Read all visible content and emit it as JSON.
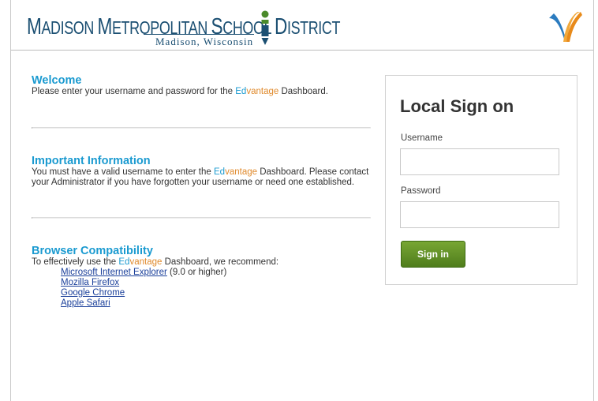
{
  "header": {
    "district_name_parts": [
      "M",
      "ADISON ",
      "M",
      "ETROPOLITAN ",
      "S",
      "CHOOL ",
      "D",
      "ISTRICT"
    ],
    "district_location": "Madison, Wisconsin",
    "logo_icon": "mmsd-pencil-logo-icon",
    "brand_icon": "edvantage-logo-icon"
  },
  "welcome": {
    "title": "Welcome",
    "text_before": "Please enter your username and password for the ",
    "brand_ed": "Ed",
    "brand_vantage": "vantage",
    "text_after": " Dashboard."
  },
  "important": {
    "title": "Important Information",
    "text_before": "You must have a valid username to enter the ",
    "brand_ed": "Ed",
    "brand_vantage": "vantage",
    "text_after": " Dashboard. Please contact your Administrator if you have forgotten your username or need one established."
  },
  "browser": {
    "title": "Browser Compatibility",
    "text_before": "To effectively use the ",
    "brand_ed": "Ed",
    "brand_vantage": "vantage",
    "text_after": " Dashboard, we recommend:",
    "items": [
      {
        "link": "Microsoft Internet Explorer",
        "note": " (9.0 or higher)"
      },
      {
        "link": "Mozilla Firefox",
        "note": ""
      },
      {
        "link": "Google Chrome",
        "note": ""
      },
      {
        "link": "Apple Safari",
        "note": ""
      }
    ]
  },
  "signin": {
    "title": "Local Sign on",
    "username_label": "Username",
    "username_value": "",
    "password_label": "Password",
    "password_value": "",
    "button_label": "Sign in"
  },
  "colors": {
    "accent_blue": "#1a9ad0",
    "accent_orange": "#e08a2c",
    "button_green": "#5f8f22",
    "logo_navy": "#1b4f72"
  }
}
